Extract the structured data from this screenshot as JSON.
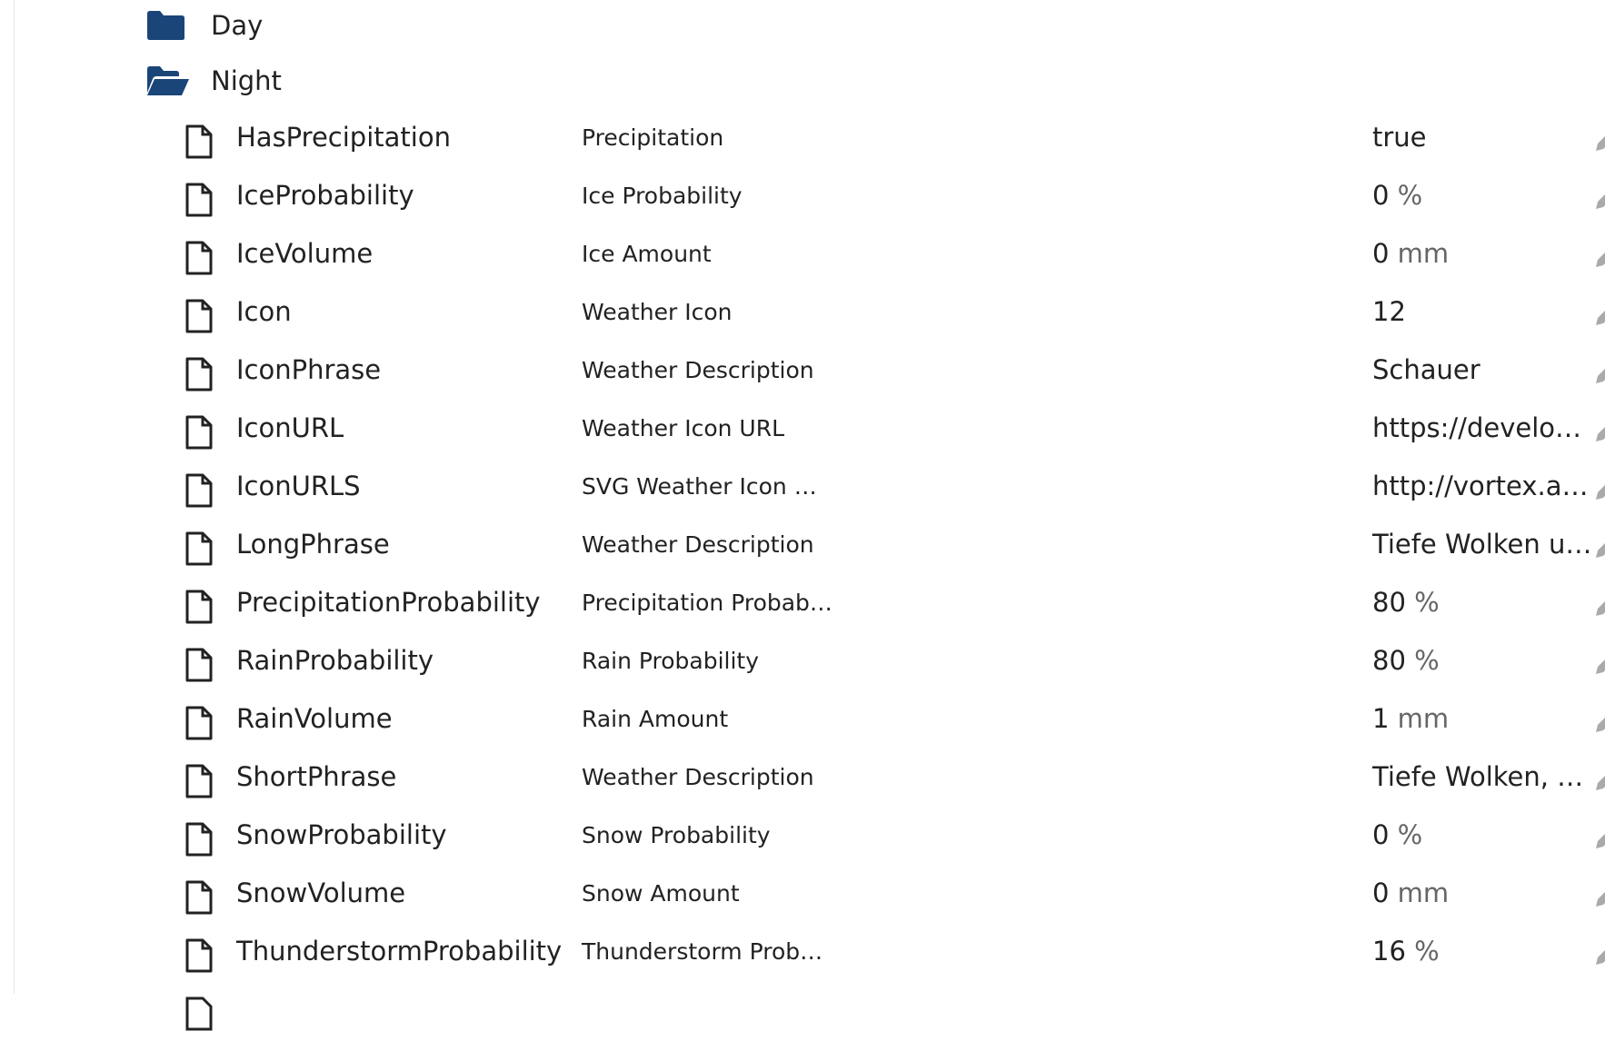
{
  "folders": [
    {
      "label": "Day",
      "state": "closed",
      "icon": "folder-icon"
    },
    {
      "label": "Night",
      "state": "open",
      "icon": "folder-open-icon"
    }
  ],
  "colors": {
    "folder": "#1a4578",
    "text": "#222222",
    "unit": "#666666",
    "edit_icon": "#aaaaaa"
  },
  "rows": [
    {
      "name": "HasPrecipitation",
      "label": "Precipitation",
      "value": "true",
      "unit": ""
    },
    {
      "name": "IceProbability",
      "label": "Ice Probability",
      "value": "0",
      "unit": "%"
    },
    {
      "name": "IceVolume",
      "label": "Ice Amount",
      "value": "0",
      "unit": "mm"
    },
    {
      "name": "Icon",
      "label": "Weather Icon",
      "value": "12",
      "unit": ""
    },
    {
      "name": "IconPhrase",
      "label": "Weather Description",
      "value": "Schauer",
      "unit": ""
    },
    {
      "name": "IconURL",
      "label": "Weather Icon URL",
      "value": "https://develo…",
      "unit": ""
    },
    {
      "name": "IconURLS",
      "label": "SVG Weather Icon …",
      "value": "http://vortex.a…",
      "unit": ""
    },
    {
      "name": "LongPhrase",
      "label": "Weather Description",
      "value": "Tiefe Wolken u…",
      "unit": ""
    },
    {
      "name": "PrecipitationProbability",
      "label": "Precipitation Probab…",
      "value": "80",
      "unit": "%"
    },
    {
      "name": "RainProbability",
      "label": "Rain Probability",
      "value": "80",
      "unit": "%"
    },
    {
      "name": "RainVolume",
      "label": "Rain Amount",
      "value": "1",
      "unit": "mm"
    },
    {
      "name": "ShortPhrase",
      "label": "Weather Description",
      "value": "Tiefe Wolken, …",
      "unit": ""
    },
    {
      "name": "SnowProbability",
      "label": "Snow Probability",
      "value": "0",
      "unit": "%"
    },
    {
      "name": "SnowVolume",
      "label": "Snow Amount",
      "value": "0",
      "unit": "mm"
    },
    {
      "name": "ThunderstormProbability",
      "label": "Thunderstorm Prob…",
      "value": "16",
      "unit": "%"
    }
  ]
}
